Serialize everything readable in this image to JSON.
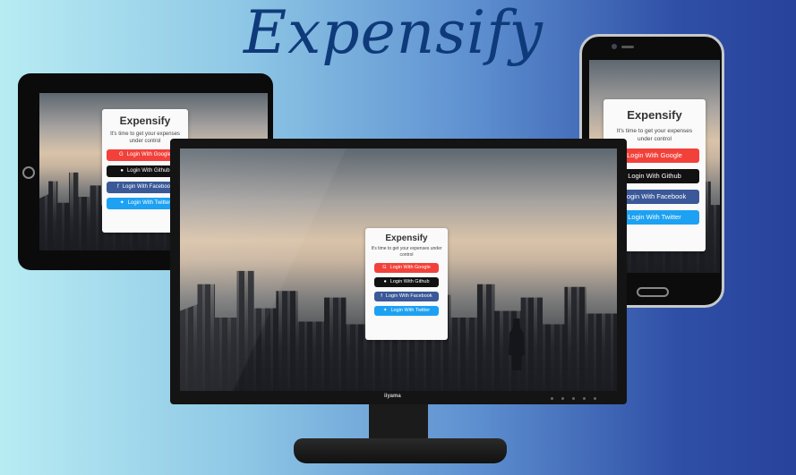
{
  "page": {
    "title": "Expensify"
  },
  "card": {
    "title": "Expensify",
    "subtitle": "It's time to get your expenses under control",
    "buttons": [
      {
        "id": "google",
        "label": "Login With Google",
        "icon": "G",
        "icon_name": "google-icon",
        "color": "#f2413a"
      },
      {
        "id": "github",
        "label": "Login With Github",
        "icon": "●",
        "icon_name": "github-icon",
        "color": "#111111"
      },
      {
        "id": "facebook",
        "label": "Login With Facebook",
        "icon": "f",
        "icon_name": "facebook-icon",
        "color": "#3b5998"
      },
      {
        "id": "twitter",
        "label": "Login With Twitter",
        "icon": "✦",
        "icon_name": "twitter-icon",
        "color": "#1da1f2"
      }
    ]
  },
  "monitor": {
    "brand": "iiyama"
  }
}
